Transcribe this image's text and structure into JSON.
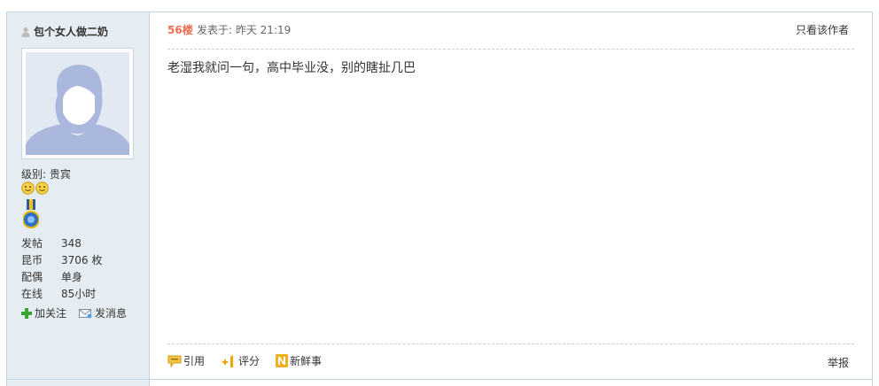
{
  "sidebar": {
    "author_name": "包个女人做二奶",
    "level_label": "级别: 贵宾",
    "stats": [
      {
        "key": "发帖",
        "value": "348"
      },
      {
        "key": "昆币",
        "value": "3706 枚"
      },
      {
        "key": "配偶",
        "value": "单身"
      },
      {
        "key": "在线",
        "value": "85小时"
      }
    ],
    "follow_label": "加关注",
    "message_label": "发消息"
  },
  "post": {
    "floor": "56楼",
    "posted_at": "发表于: 昨天 21:19",
    "only_author": "只看该作者",
    "text": "老湿我就问一句，高中毕业没，别的瞎扯几巴",
    "footer": {
      "quote": "引用",
      "rate": "评分",
      "news": "新鲜事",
      "report": "举报"
    }
  },
  "colors": {
    "sidebar_bg": "#e5edf2",
    "border": "#c2d5e3",
    "floor": "#f26c4f"
  }
}
